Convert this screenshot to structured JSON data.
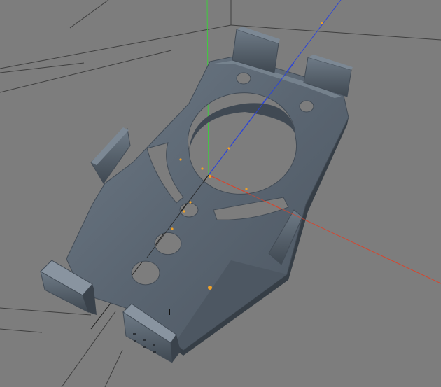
{
  "app": {
    "view": "3d-viewport-perspective",
    "background_color": "#7d7d7d"
  },
  "scene": {
    "grid_color": "#3f3f3f",
    "axis_colors": {
      "x": "#d8442c",
      "y": "#3ecb3e",
      "z": "#2c44d8"
    },
    "model_color": "#596470",
    "model_edge_color": "#434c56",
    "model_highlight_color": "#7c8894",
    "vertex_color": "#f0a228",
    "icons": [
      "world-origin-icon",
      "vertex-point-icon",
      "object-pivot-icon"
    ]
  }
}
